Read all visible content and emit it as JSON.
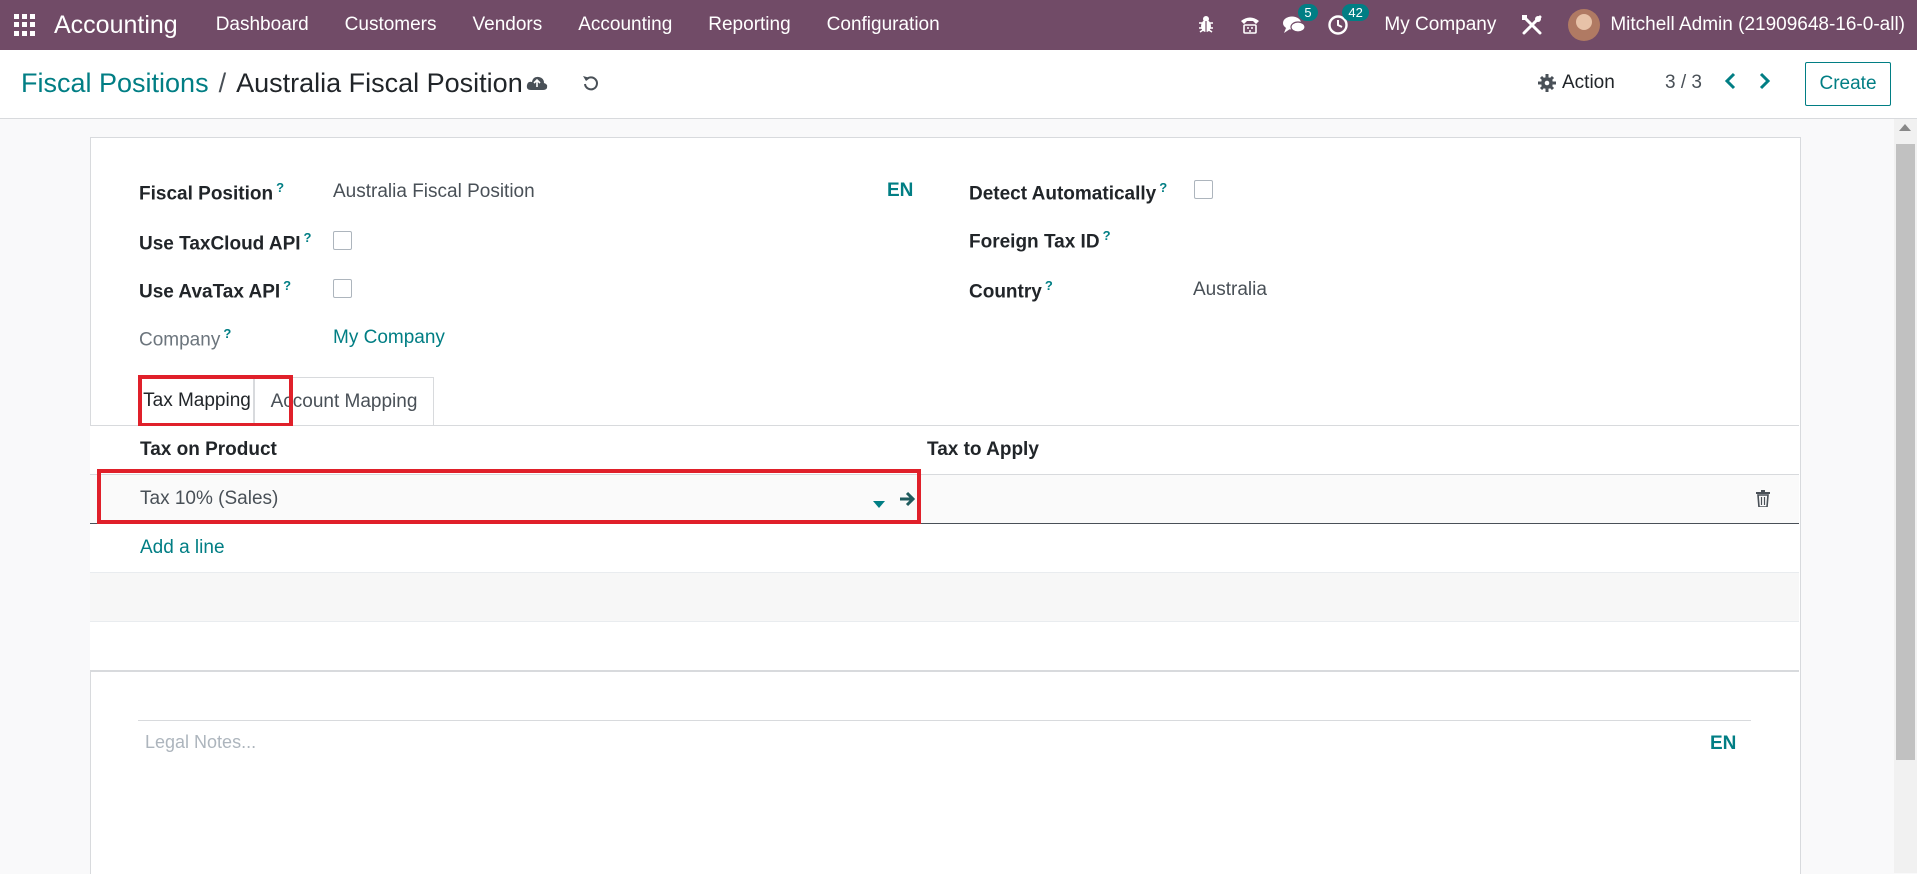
{
  "nav": {
    "app_name": "Accounting",
    "menu": [
      "Dashboard",
      "Customers",
      "Vendors",
      "Accounting",
      "Reporting",
      "Configuration"
    ],
    "messages_count": "5",
    "activities_count": "42",
    "company": "My Company",
    "user": "Mitchell Admin (21909648-16-0-all)"
  },
  "control": {
    "breadcrumb_parent": "Fiscal Positions",
    "breadcrumb_sep": "/",
    "breadcrumb_current": "Australia Fiscal Position",
    "action_label": "Action",
    "pager": "3 / 3",
    "create_label": "Create"
  },
  "form": {
    "fiscal_position_label": "Fiscal Position",
    "fiscal_position_value": "Australia Fiscal Position",
    "lang_code": "EN",
    "taxcloud_label": "Use TaxCloud API",
    "avatax_label": "Use AvaTax API",
    "company_label": "Company",
    "company_value": "My Company",
    "detect_label": "Detect Automatically",
    "foreign_tax_label": "Foreign Tax ID",
    "country_label": "Country",
    "country_value": "Australia",
    "help_mark": "?"
  },
  "tabs": {
    "tax_mapping": "Tax Mapping",
    "account_mapping": "Account Mapping"
  },
  "table": {
    "col_tax_on_product": "Tax on Product",
    "col_tax_to_apply": "Tax to Apply",
    "row_tax_on_product": "Tax 10% (Sales)",
    "add_line": "Add a line"
  },
  "notes": {
    "placeholder": "Legal Notes...",
    "lang_code": "EN"
  },
  "colors": {
    "brand": "#714b67",
    "accent": "#017e84",
    "highlight": "#e0202a"
  }
}
